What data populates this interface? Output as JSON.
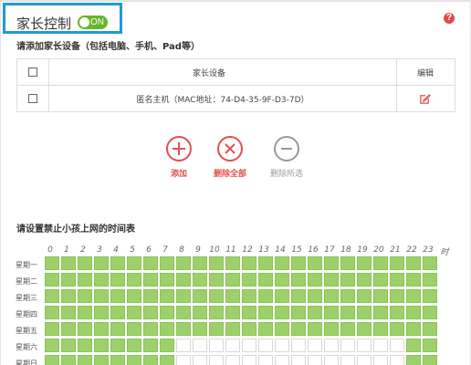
{
  "header": {
    "title": "家长控制",
    "toggle_label": "ON"
  },
  "devices": {
    "heading": "请添加家长设备（包括电脑、手机、Pad等）",
    "columns": {
      "device": "家长设备",
      "edit": "编辑"
    },
    "rows": [
      {
        "name": "匿名主机（MAC地址：74-D4-35-9F-D3-7D）"
      }
    ]
  },
  "actions": {
    "add": "添加",
    "delete_all": "删除全部",
    "delete_selected": "删除所选"
  },
  "schedule": {
    "heading": "请设置禁止小孩上网的时间表",
    "hours": [
      "0",
      "1",
      "2",
      "3",
      "4",
      "5",
      "6",
      "7",
      "8",
      "9",
      "10",
      "11",
      "12",
      "13",
      "14",
      "15",
      "16",
      "17",
      "18",
      "19",
      "20",
      "21",
      "22",
      "23",
      "时"
    ],
    "days": [
      "星期一",
      "星期二",
      "星期三",
      "星期四",
      "星期五",
      "星期六",
      "星期日"
    ],
    "blocked": [
      [
        1,
        1,
        1,
        1,
        1,
        1,
        1,
        1,
        1,
        1,
        1,
        1,
        1,
        1,
        1,
        1,
        1,
        1,
        1,
        1,
        1,
        1,
        1,
        1
      ],
      [
        1,
        1,
        1,
        1,
        1,
        1,
        1,
        1,
        1,
        1,
        1,
        1,
        1,
        1,
        1,
        1,
        1,
        1,
        1,
        1,
        1,
        1,
        1,
        1
      ],
      [
        1,
        1,
        1,
        1,
        1,
        1,
        1,
        1,
        1,
        1,
        1,
        1,
        1,
        1,
        1,
        1,
        1,
        1,
        1,
        1,
        1,
        1,
        1,
        1
      ],
      [
        1,
        1,
        1,
        1,
        1,
        1,
        1,
        1,
        1,
        1,
        1,
        1,
        1,
        1,
        1,
        1,
        1,
        1,
        1,
        1,
        1,
        1,
        1,
        1
      ],
      [
        1,
        1,
        1,
        1,
        1,
        1,
        1,
        1,
        1,
        1,
        1,
        1,
        1,
        1,
        1,
        1,
        1,
        1,
        1,
        1,
        1,
        1,
        1,
        1
      ],
      [
        1,
        1,
        1,
        1,
        1,
        1,
        1,
        1,
        0,
        0,
        0,
        0,
        0,
        0,
        0,
        0,
        0,
        0,
        0,
        0,
        0,
        0,
        1,
        1
      ],
      [
        1,
        1,
        1,
        1,
        1,
        1,
        1,
        1,
        0,
        0,
        0,
        0,
        0,
        0,
        0,
        0,
        0,
        0,
        0,
        0,
        0,
        0,
        1,
        1
      ]
    ]
  },
  "colors": {
    "accent": "#1e9ad6",
    "on": "#66b629",
    "danger": "#e25050",
    "cell_on": "#9cd06a"
  }
}
